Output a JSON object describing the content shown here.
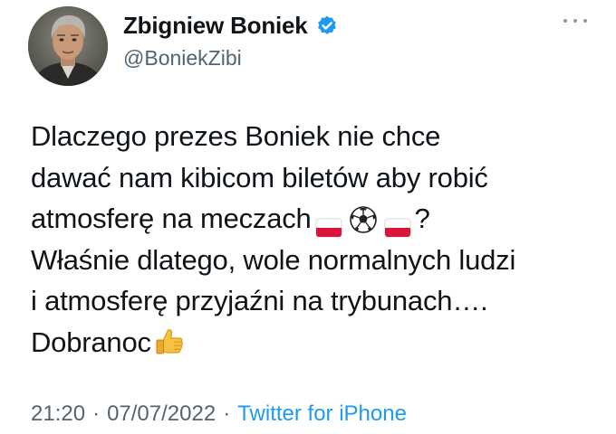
{
  "author": {
    "display_name": "Zbigniew Boniek",
    "handle": "@BoniekZibi",
    "verified": true
  },
  "tweet": {
    "lines": [
      "Dlaczego prezes Boniek nie chce",
      "dawać nam kibicom biletów aby robić",
      "atmosferę na meczach",
      "?",
      "Właśnie dlatego, wole normalnych ludzi",
      "i atmosferę przyjaźni na trybunach….",
      "Dobranoc"
    ]
  },
  "meta": {
    "time": "21:20",
    "separator": "·",
    "date": "07/07/2022",
    "source": "Twitter for iPhone"
  },
  "icons": {
    "verified": "verified-badge-icon",
    "more": "more-options-icon",
    "flag": "poland-flag-emoji",
    "ball": "soccer-ball-emoji",
    "thumb": "thumbs-up-emoji"
  },
  "colors": {
    "text": "#0f1419",
    "secondary": "#536471",
    "link": "#1d9bf0"
  }
}
